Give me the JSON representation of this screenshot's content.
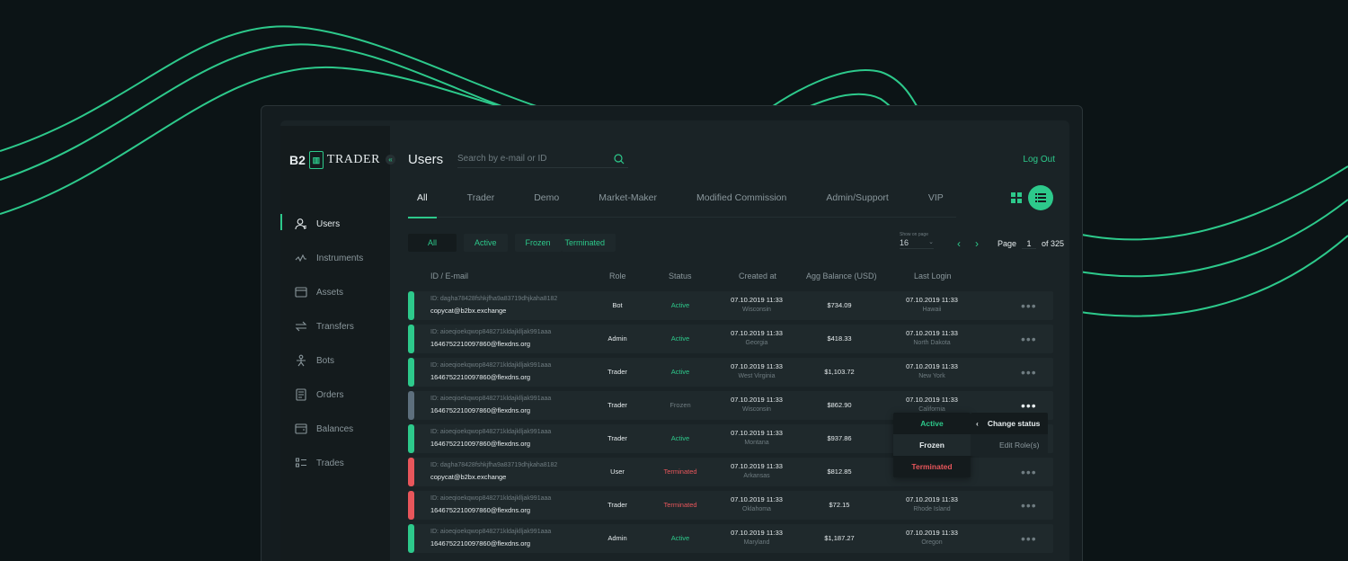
{
  "brand": {
    "logo_left": "B2",
    "logo_right": "TRADER",
    "collapse_icon": "«"
  },
  "sidebar": {
    "items": [
      {
        "label": "Users",
        "icon": "user-icon",
        "active": true
      },
      {
        "label": "Instruments",
        "icon": "chart-line-icon",
        "active": false
      },
      {
        "label": "Assets",
        "icon": "folder-icon",
        "active": false
      },
      {
        "label": "Transfers",
        "icon": "transfer-arrows-icon",
        "active": false
      },
      {
        "label": "Bots",
        "icon": "bot-icon",
        "active": false
      },
      {
        "label": "Orders",
        "icon": "orders-icon",
        "active": false
      },
      {
        "label": "Balances",
        "icon": "wallet-icon",
        "active": false
      },
      {
        "label": "Trades",
        "icon": "trades-list-icon",
        "active": false
      }
    ]
  },
  "header": {
    "title": "Users",
    "search_placeholder": "Search by e-mail or ID",
    "logout": "Log Out"
  },
  "tabs": [
    "All",
    "Trader",
    "Demo",
    "Market-Maker",
    "Modified Commission",
    "Admin/Support",
    "VIP"
  ],
  "filters": [
    "All",
    "Active",
    "Frozen",
    "Terminated"
  ],
  "pagination": {
    "show_on_page_label": "Show on page",
    "show_on_page_value": "16",
    "page_label": "Page",
    "page_value": "1",
    "of_label": "of 325"
  },
  "table": {
    "headers": {
      "id": "ID / E-mail",
      "role": "Role",
      "status": "Status",
      "created": "Created at",
      "balance": "Agg Balance (USD)",
      "last": "Last Login"
    },
    "rows": [
      {
        "id": "ID: dagha78428fshkjfha9a83719dhjkaha8182",
        "email": "copycat@b2bx.exchange",
        "role": "Bot",
        "status": "Active",
        "created": "07.10.2019 11:33",
        "created_loc": "Wisconsin",
        "balance": "$734.09",
        "last": "07.10.2019 11:33",
        "last_loc": "Hawaii"
      },
      {
        "id": "ID: aioeqioekqwop848271kldajklljak991aaa",
        "email": "1646752210097860@flexdns.org",
        "role": "Admin",
        "status": "Active",
        "created": "07.10.2019 11:33",
        "created_loc": "Georgia",
        "balance": "$418.33",
        "last": "07.10.2019 11:33",
        "last_loc": "North Dakota"
      },
      {
        "id": "ID: aioeqioekqwop848271kldajklljak991aaa",
        "email": "1646752210097860@flexdns.org",
        "role": "Trader",
        "status": "Active",
        "created": "07.10.2019 11:33",
        "created_loc": "West Virginia",
        "balance": "$1,103.72",
        "last": "07.10.2019 11:33",
        "last_loc": "New York"
      },
      {
        "id": "ID: aioeqioekqwop848271kldajklljak991aaa",
        "email": "1646752210097860@flexdns.org",
        "role": "Trader",
        "status": "Frozen",
        "created": "07.10.2019 11:33",
        "created_loc": "Wisconsin",
        "balance": "$862.90",
        "last": "07.10.2019 11:33",
        "last_loc": "California"
      },
      {
        "id": "ID: aioeqioekqwop848271kldajklljak991aaa",
        "email": "1646752210097860@flexdns.org",
        "role": "Trader",
        "status": "Active",
        "created": "07.10.2019 11:33",
        "created_loc": "Montana",
        "balance": "$937.86",
        "last": "",
        "last_loc": ""
      },
      {
        "id": "ID: dagha78428fshkjfha9a83719dhjkaha8182",
        "email": "copycat@b2bx.exchange",
        "role": "User",
        "status": "Terminated",
        "created": "07.10.2019 11:33",
        "created_loc": "Arkansas",
        "balance": "$812.85",
        "last": "",
        "last_loc": ""
      },
      {
        "id": "ID: aioeqioekqwop848271kldajklljak991aaa",
        "email": "1646752210097860@flexdns.org",
        "role": "Trader",
        "status": "Terminated",
        "created": "07.10.2019 11:33",
        "created_loc": "Oklahoma",
        "balance": "$72.15",
        "last": "07.10.2019 11:33",
        "last_loc": "Rhode Island"
      },
      {
        "id": "ID: aioeqioekqwop848271kldajklljak991aaa",
        "email": "1646752210097860@flexdns.org",
        "role": "Admin",
        "status": "Active",
        "created": "07.10.2019 11:33",
        "created_loc": "Maryland",
        "balance": "$1,187.27",
        "last": "07.10.2019 11:33",
        "last_loc": "Oregon"
      }
    ]
  },
  "context_menu": {
    "change_status": "Change status",
    "edit_roles": "Edit Role(s)",
    "statuses": [
      "Active",
      "Frozen",
      "Terminated"
    ],
    "chevron_icon": "chevron-left-icon"
  },
  "colors": {
    "accent": "#2dc98b",
    "frozen": "#5d6f7d",
    "terminated": "#e8565b",
    "background": "#0c1416"
  }
}
